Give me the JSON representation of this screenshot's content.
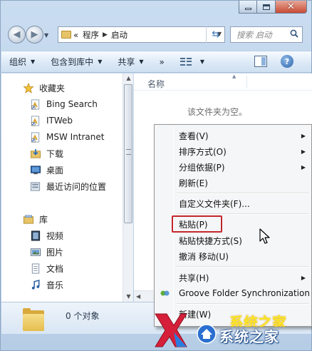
{
  "window": {
    "caption_buttons": [
      "minimize-icon",
      "maximize-icon",
      "close-icon"
    ]
  },
  "address": {
    "overflow": "«",
    "breadcrumbs": [
      "程序",
      "启动"
    ],
    "search_placeholder": "搜索 启动"
  },
  "toolbar": {
    "organize": "组织",
    "include_in_library": "包含到库中",
    "share": "共享",
    "more": "»"
  },
  "sidebar": {
    "favorites_title": "收藏夹",
    "favorites": [
      {
        "label": "Bing Search",
        "icon": "shortcut-icon"
      },
      {
        "label": "ITWeb",
        "icon": "shortcut-icon"
      },
      {
        "label": "MSW Intranet",
        "icon": "shortcut-icon"
      },
      {
        "label": "下载",
        "icon": "download-folder-icon"
      },
      {
        "label": "桌面",
        "icon": "desktop-icon"
      },
      {
        "label": "最近访问的位置",
        "icon": "recent-places-icon"
      }
    ],
    "libraries_title": "库",
    "libraries": [
      {
        "label": "视频",
        "icon": "video-library-icon"
      },
      {
        "label": "图片",
        "icon": "pictures-library-icon"
      },
      {
        "label": "文档",
        "icon": "documents-library-icon"
      },
      {
        "label": "音乐",
        "icon": "music-library-icon"
      }
    ]
  },
  "content": {
    "column_name": "名称",
    "empty_message": "该文件夹为空。"
  },
  "details": {
    "item_count": "0 个对象"
  },
  "context_menu": {
    "items": [
      {
        "label": "查看(V)",
        "submenu": true
      },
      {
        "label": "排序方式(O)",
        "submenu": true
      },
      {
        "label": "分组依据(P)",
        "submenu": true
      },
      {
        "label": "刷新(E)",
        "submenu": false
      },
      {
        "label": "自定义文件夹(F)...",
        "submenu": false
      },
      {
        "label": "粘贴(P)",
        "submenu": false,
        "highlighted": true
      },
      {
        "label": "粘贴快捷方式(S)",
        "submenu": false
      },
      {
        "label": "撤消 移动(U)",
        "submenu": false
      },
      {
        "label": "共享(H)",
        "submenu": true
      },
      {
        "label": "Groove Folder Synchronization",
        "submenu": true,
        "icon": "groove-icon"
      },
      {
        "label": "新建(W)",
        "submenu": true
      }
    ],
    "highlight_color": "#c3272d"
  },
  "watermark": {
    "site_name": "系统之家",
    "glow_text": "系统之家"
  }
}
